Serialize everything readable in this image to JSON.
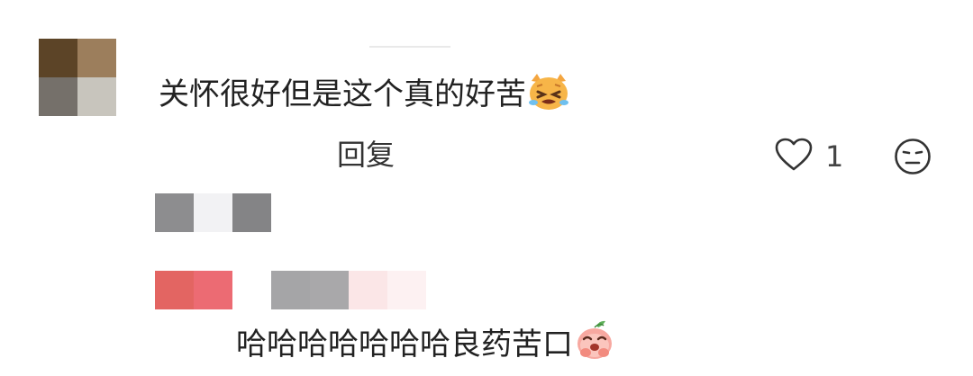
{
  "comment": {
    "text": "关怀很好但是这个真的好苦",
    "emoji": "crying-cat-emoji",
    "reply_label": "回复",
    "like_count": "1"
  },
  "reply": {
    "text": "哈哈哈哈哈哈哈良药苦口",
    "emoji": "peach-laughing-emoji"
  },
  "colors": {
    "avatar": [
      "#5c4427",
      "#9c7e5c",
      "#75706a",
      "#c8c5bd"
    ],
    "blur_gray_dark": "#8d8d8f",
    "blur_gray_light": "#f2f2f4",
    "blur_red": "#e56a6a",
    "blur_pink_light": "#fbe9ea"
  }
}
